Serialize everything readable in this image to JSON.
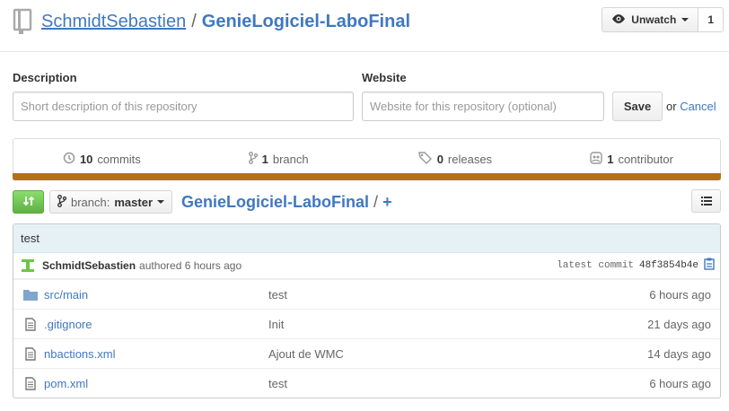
{
  "repo": {
    "owner": "SchmidtSebastien",
    "separator": "/",
    "name": "GenieLogiciel-LaboFinal"
  },
  "watch": {
    "label": "Unwatch",
    "count": "1"
  },
  "form": {
    "description_label": "Description",
    "description_placeholder": "Short description of this repository",
    "website_label": "Website",
    "website_placeholder": "Website for this repository (optional)",
    "save_label": "Save",
    "or_text": "or",
    "cancel_label": "Cancel"
  },
  "summary": {
    "commits_count": "10",
    "commits_label": "commits",
    "branch_count": "1",
    "branch_label": "branch",
    "releases_count": "0",
    "releases_label": "releases",
    "contributor_count": "1",
    "contributor_label": "contributor",
    "language_color": "#b07219"
  },
  "file_nav": {
    "branch_label": "branch:",
    "branch_value": "master",
    "breadcrumb_root": "GenieLogiciel-LaboFinal",
    "breadcrumb_slash": "/",
    "breadcrumb_plus": "+"
  },
  "commit": {
    "message": "test",
    "author": "SchmidtSebastien",
    "authored": "authored 6 hours ago",
    "latest_label": "latest commit",
    "sha": "48f3854b4e"
  },
  "files": [
    {
      "name": "src/main",
      "type": "folder",
      "message": "test",
      "age": "6 hours ago"
    },
    {
      "name": ".gitignore",
      "type": "file",
      "message": "Init",
      "age": "21 days ago"
    },
    {
      "name": "nbactions.xml",
      "type": "file",
      "message": "Ajout de WMC",
      "age": "14 days ago"
    },
    {
      "name": "pom.xml",
      "type": "file",
      "message": "test",
      "age": "6 hours ago"
    }
  ]
}
